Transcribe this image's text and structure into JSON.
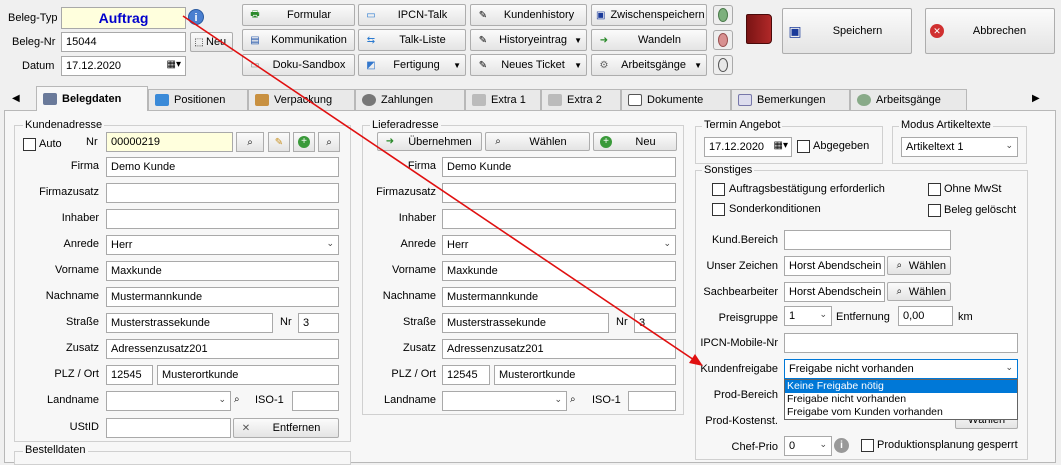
{
  "header": {
    "beleg_typ_label": "Beleg-Typ",
    "beleg_typ_value": "Auftrag",
    "beleg_nr_label": "Beleg-Nr",
    "beleg_nr_value": "15044",
    "neu_label": "Neu",
    "datum_label": "Datum",
    "datum_value": "17.12.2020"
  },
  "toolbar": {
    "formular": "Formular",
    "kommunikation": "Kommunikation",
    "doku_sandbox": "Doku-Sandbox",
    "ipcn_talk": "IPCN-Talk",
    "talk_liste": "Talk-Liste",
    "fertigung": "Fertigung",
    "kundenhistory": "Kundenhistory",
    "historyeintrag": "Historyeintrag",
    "neues_ticket": "Neues Ticket",
    "zwischenspeichern": "Zwischenspeichern",
    "wandeln": "Wandeln",
    "arbeitsgaenge": "Arbeitsgänge",
    "speichern": "Speichern",
    "abbrechen": "Abbrechen"
  },
  "tabs": [
    "Belegdaten",
    "Positionen",
    "Verpackung",
    "Zahlungen",
    "Extra 1",
    "Extra 2",
    "Dokumente",
    "Bemerkungen",
    "Arbeitsgänge"
  ],
  "kunde": {
    "group_label": "Kundenadresse",
    "auto_label": "Auto",
    "nr_label": "Nr",
    "nr_value": "00000219",
    "firma_label": "Firma",
    "firma_value": "Demo Kunde",
    "firmazusatz_label": "Firmazusatz",
    "inhaber_label": "Inhaber",
    "anrede_label": "Anrede",
    "anrede_value": "Herr",
    "vorname_label": "Vorname",
    "vorname_value": "Maxkunde",
    "nachname_label": "Nachname",
    "nachname_value": "Mustermannkunde",
    "strasse_label": "Straße",
    "strasse_value": "Musterstrassekunde",
    "hnr_label": "Nr",
    "hnr_value": "3",
    "zusatz_label": "Zusatz",
    "zusatz_value": "Adressenzusatz201",
    "plz_label": "PLZ / Ort",
    "plz_value": "12545",
    "ort_value": "Musterortkunde",
    "land_label": "Landname",
    "iso_label": "ISO-1",
    "ustid_label": "UStID",
    "entfernen_label": "Entfernen"
  },
  "liefer": {
    "group_label": "Lieferadresse",
    "uebernehmen": "Übernehmen",
    "waehlen": "Wählen",
    "neu": "Neu",
    "firma_label": "Firma",
    "firma_value": "Demo Kunde",
    "firmazusatz_label": "Firmazusatz",
    "inhaber_label": "Inhaber",
    "anrede_label": "Anrede",
    "anrede_value": "Herr",
    "vorname_label": "Vorname",
    "vorname_value": "Maxkunde",
    "nachname_label": "Nachname",
    "nachname_value": "Mustermannkunde",
    "strasse_label": "Straße",
    "strasse_value": "Musterstrassekunde",
    "hnr_label": "Nr",
    "hnr_value": "3",
    "zusatz_label": "Zusatz",
    "zusatz_value": "Adressenzusatz201",
    "plz_label": "PLZ / Ort",
    "plz_value": "12545",
    "ort_value": "Musterortkunde",
    "land_label": "Landname",
    "iso_label": "ISO-1"
  },
  "termin": {
    "group_label": "Termin Angebot",
    "date_value": "17.12.2020",
    "abgegeben_label": "Abgegeben"
  },
  "modus": {
    "group_label": "Modus Artikeltexte",
    "value": "Artikeltext 1"
  },
  "sonstiges": {
    "group_label": "Sonstiges",
    "auftragsbest_label": "Auftragsbestätigung erforderlich",
    "ohne_mwst_label": "Ohne MwSt",
    "sonderkond_label": "Sonderkonditionen",
    "beleg_geloescht_label": "Beleg gelöscht",
    "kund_bereich_label": "Kund.Bereich",
    "unser_zeichen_label": "Unser Zeichen",
    "unser_zeichen_value": "Horst Abendschein",
    "sachbearbeiter_label": "Sachbearbeiter",
    "sachbearbeiter_value": "Horst Abendschein",
    "waehlen_label": "Wählen",
    "preisgruppe_label": "Preisgruppe",
    "preisgruppe_value": "1",
    "entfernung_label": "Entfernung",
    "entfernung_value": "0,00",
    "km_label": "km",
    "ipcn_mobile_label": "IPCN-Mobile-Nr",
    "kundenfreigabe_label": "Kundenfreigabe",
    "kundenfreigabe_value": "Freigabe nicht vorhanden",
    "freigabe_options": [
      "Keine Freigabe nötig",
      "Freigabe nicht vorhanden",
      "Freigabe vom Kunden vorhanden"
    ],
    "prod_bereich_label": "Prod-Bereich",
    "prod_kostenst_label": "Prod-Kostenst.",
    "chef_prio_label": "Chef-Prio",
    "chef_prio_value": "0",
    "produktionsplanung_label": "Produktionsplanung gesperrt"
  },
  "bestelldaten": {
    "group_label": "Bestelldaten"
  },
  "colors": {
    "accent": "#0000cc",
    "arrow": "#e01010",
    "selection": "#0078d7",
    "yellow": "#ffffdd"
  }
}
